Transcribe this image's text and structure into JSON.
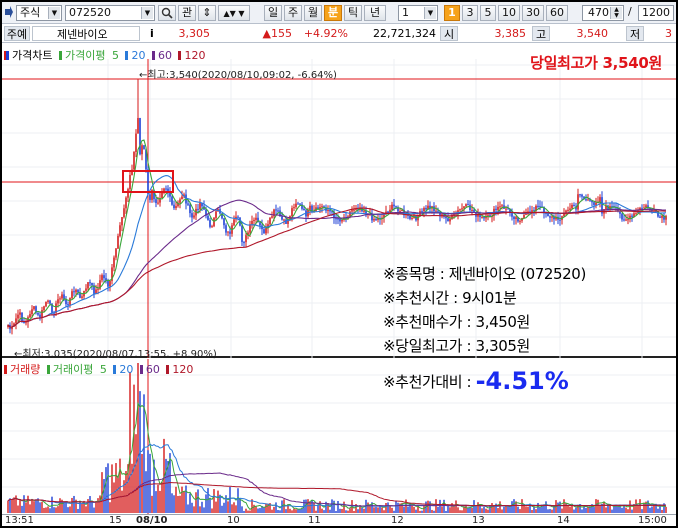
{
  "toolbar": {
    "menu_label": "주식",
    "code": "072520",
    "search_label": "관",
    "periods": [
      "일",
      "주",
      "월",
      "분",
      "틱",
      "년"
    ],
    "active_period": "분",
    "period_count": "1",
    "intervals": [
      "1",
      "3",
      "5",
      "10",
      "30",
      "60"
    ],
    "active_interval": "1",
    "count_value": "470",
    "divider": "/",
    "total_value": "1200"
  },
  "quote": {
    "tab_label": "주예",
    "stock_name": "제넨바이오",
    "info_icon": "i",
    "price": "3,305",
    "change": "▲155",
    "change_pct": "+4.92%",
    "volume": "22,721,324",
    "open_label": "시",
    "open_value": "3,385",
    "high_label": "고",
    "high_value": "3,540",
    "low_label": "저",
    "low_value": "3"
  },
  "price_panel": {
    "legend_title": "가격차트",
    "ma_legend": "가격이평",
    "ma_periods": [
      "5",
      "20",
      "60",
      "120"
    ],
    "high_annotation": "←최고:3,540(2020/08/10,09:02, -6.64%)",
    "low_annotation": "←최저:3,035(2020/08/07,13:55, +8.90%)",
    "headline": "당일최고가 3,540원",
    "info_lines": [
      "※종목명 : 제넨바이오 (072520)",
      "※추천시간 : 9시01분",
      "※추천매수가 : 3,450원",
      "※당일최고가 : 3,305원"
    ],
    "return_label": "※추천가대비 :",
    "return_value": "-4.51%"
  },
  "volume_panel": {
    "legend_title": "거래량",
    "ma_legend": "거래이평",
    "ma_periods": [
      "5",
      "20",
      "60",
      "120"
    ]
  },
  "xaxis": {
    "labels": [
      "13:51",
      "15",
      "08/10",
      "10",
      "11",
      "12",
      "13",
      "14",
      "15:00"
    ]
  },
  "colors": {
    "up": "#d41a1a",
    "down": "#1c3fd6",
    "ma5": "#3aa63a",
    "ma20": "#2a7ad9",
    "ma60": "#6a2a8a",
    "ma120": "#b0182a",
    "reference_line": "#e0141a",
    "highlight_box": "#e0141a",
    "return_value": "#1a2bf0"
  },
  "chart_data": {
    "type": "candlestick",
    "title": "",
    "x_labels": [
      "13:51",
      "15",
      "08/10",
      "10",
      "11",
      "12",
      "13",
      "14",
      "15:00"
    ],
    "price_high": 3540,
    "price_low": 3035,
    "reference_price": 3450,
    "series": [
      {
        "name": "가격이평 5"
      },
      {
        "name": "20"
      },
      {
        "name": "60"
      },
      {
        "name": "120"
      }
    ]
  }
}
